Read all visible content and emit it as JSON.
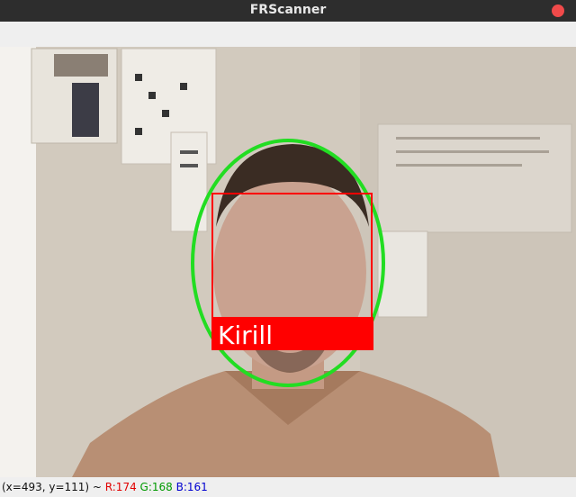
{
  "window": {
    "title": "FRScanner"
  },
  "detection": {
    "name_label": "Kirill"
  },
  "statusbar": {
    "coords": "(x=493, y=111) ~ ",
    "r": "R:174",
    "g": "G:168",
    "b": "B:161"
  },
  "colors": {
    "ellipse": "#22dd22",
    "box": "#ff0000",
    "label_bg": "#ff0000",
    "label_text": "#ffffff"
  }
}
